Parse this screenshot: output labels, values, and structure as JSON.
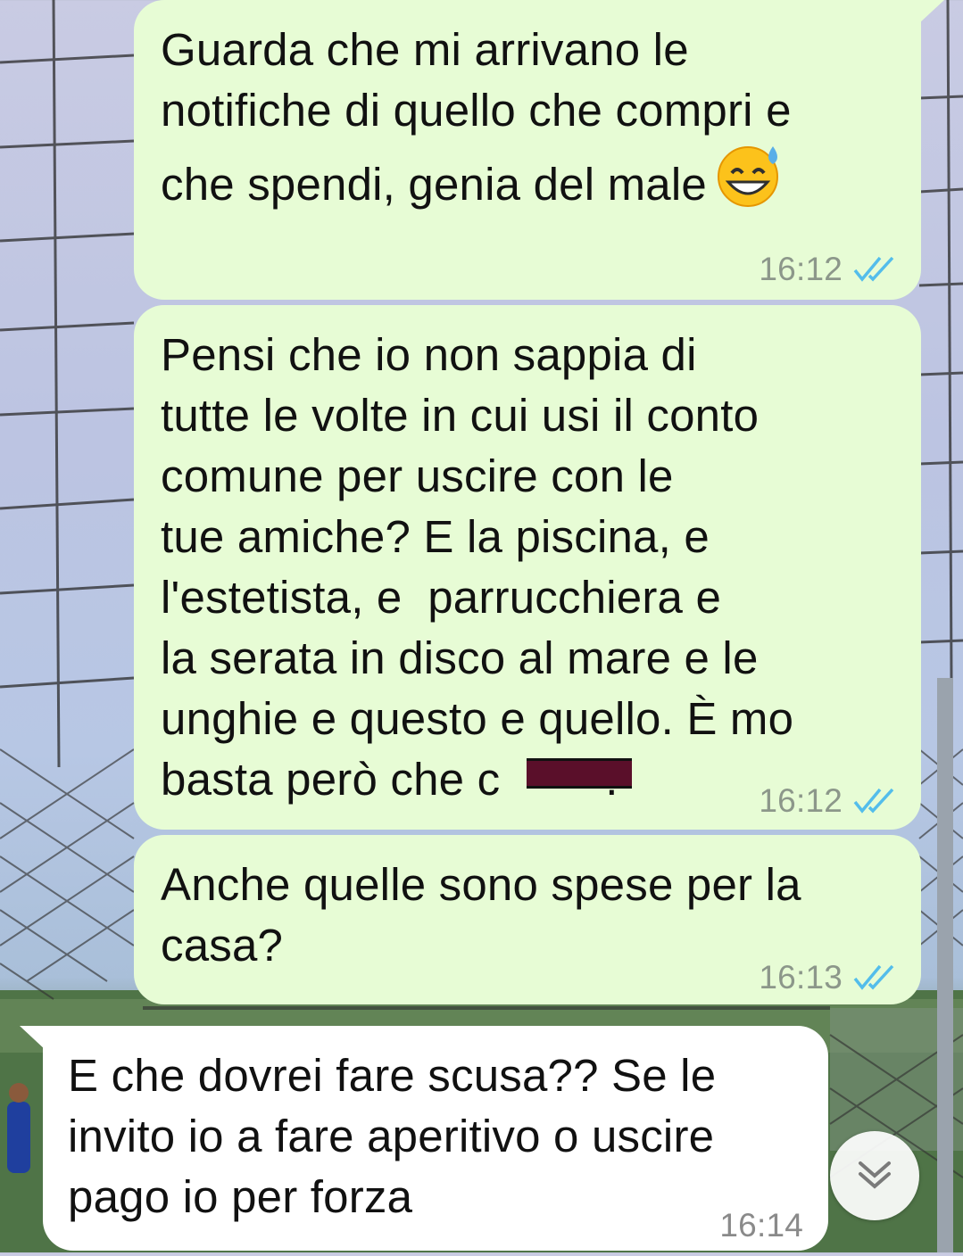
{
  "messages": [
    {
      "dir": "out",
      "text": "Guarda che mi arrivano le\nnotifiche di quello che compri e\nche spendi, genia del male",
      "emoji": "grinning-sweat-emoji",
      "time": "16:12",
      "status_icon": "double-check-read-icon"
    },
    {
      "dir": "out",
      "text": "Pensi che io non sappia di\ntutte le volte in cui usi il conto\ncomune per uscire con le\ntue amiche? E la piscina, e\nl'estetista, e  parrucchiera e\nla serata in disco al mare e le\nunghie e questo e quello. È mo\nbasta però che c",
      "text_tail": ".",
      "time": "16:12",
      "status_icon": "double-check-read-icon"
    },
    {
      "dir": "out",
      "text": "Anche quelle sono spese per la\ncasa?",
      "time": "16:13",
      "status_icon": "double-check-read-icon"
    },
    {
      "dir": "in",
      "text": "E che dovrei fare scusa?? Se le\ninvito io a fare aperitivo o uscire\npago io per forza",
      "time": "16:14"
    }
  ],
  "scroll_button_icon": "double-chevron-down-icon",
  "colors": {
    "outgoing_bubble": "#e7fcd5",
    "incoming_bubble": "#ffffff",
    "read_tick": "#53bdeb",
    "redaction": "#5a0f2a"
  }
}
